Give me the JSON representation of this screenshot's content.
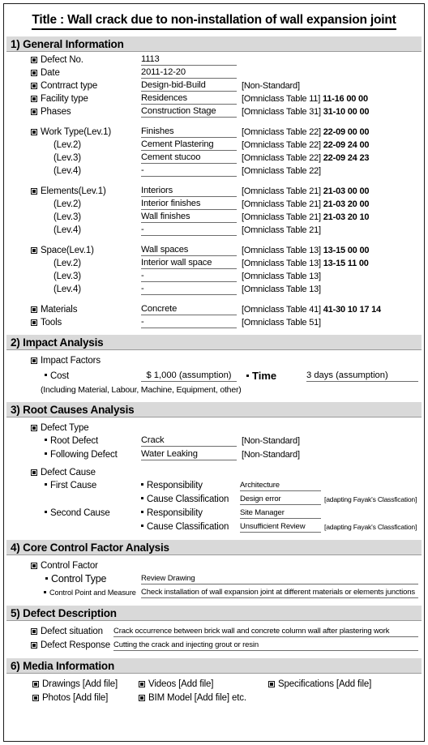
{
  "title": "Title : Wall crack due to non-installation of wall expansion joint",
  "sections": {
    "general": {
      "header": "1) General Information",
      "rows": [
        {
          "label": "Defect No.",
          "value": "1113",
          "note": ""
        },
        {
          "label": "Date",
          "value": "2011-12-20",
          "note": ""
        },
        {
          "label": "Contrract type",
          "value": "Design-bid-Build",
          "note": "[Non-Standard]",
          "code": ""
        },
        {
          "label": "Facility type",
          "value": "Residences",
          "note": "[Omniclass Table 11]",
          "code": "11-16 00 00"
        },
        {
          "label": "Phases",
          "value": "Construction Stage",
          "note": "[Omniclass Table 31]",
          "code": "31-10 00 00"
        }
      ],
      "work_type": [
        {
          "label": "Work Type(Lev.1)",
          "value": "Finishes",
          "note": "[Omniclass Table 22]",
          "code": "22-09 00 00"
        },
        {
          "label": "(Lev.2)",
          "value": "Cement Plastering",
          "note": "[Omniclass Table 22]",
          "code": "22-09 24 00"
        },
        {
          "label": "(Lev.3)",
          "value": "Cement stucoo",
          "note": "[Omniclass Table 22]",
          "code": "22-09 24 23"
        },
        {
          "label": "(Lev.4)",
          "value": "-",
          "note": "[Omniclass Table 22]",
          "code": ""
        }
      ],
      "elements": [
        {
          "label": "Elements(Lev.1)",
          "value": "Interiors",
          "note": "[Omniclass Table 21]",
          "code": "21-03 00 00"
        },
        {
          "label": "(Lev.2)",
          "value": "Interior finishes",
          "note": "[Omniclass Table 21]",
          "code": "21-03 20 00"
        },
        {
          "label": "(Lev.3)",
          "value": "Wall finishes",
          "note": "[Omniclass Table 21]",
          "code": "21-03 20 10"
        },
        {
          "label": "(Lev.4)",
          "value": "-",
          "note": "[Omniclass Table 21]",
          "code": ""
        }
      ],
      "space": [
        {
          "label": "Space(Lev.1)",
          "value": "Wall spaces",
          "note": "[Omniclass Table 13]",
          "code": "13-15 00 00"
        },
        {
          "label": "(Lev.2)",
          "value": "Interior wall space",
          "note": "[Omniclass Table 13]",
          "code": "13-15 11 00"
        },
        {
          "label": "(Lev.3)",
          "value": "-",
          "note": "[Omniclass Table 13]",
          "code": ""
        },
        {
          "label": "(Lev.4)",
          "value": "-",
          "note": "[Omniclass Table 13]",
          "code": ""
        }
      ],
      "materials": {
        "label": "Materials",
        "value": "Concrete",
        "note": "[Omniclass Table 41]",
        "code": "41-30 10 17 14"
      },
      "tools": {
        "label": "Tools",
        "value": "-",
        "note": "[Omniclass Table 51]",
        "code": ""
      }
    },
    "impact": {
      "header": "2) Impact Analysis",
      "factors_label": "Impact Factors",
      "cost_label": "Cost",
      "cost_value": "$ 1,000 (assumption)",
      "time_label": "Time",
      "time_value": "3 days (assumption)",
      "including": "(Including Material, Labour, Machine, Equipment, other)"
    },
    "root": {
      "header": "3) Root Causes Analysis",
      "defect_type_label": "Defect Type",
      "root_defect_label": "Root Defect",
      "root_defect_value": "Crack",
      "root_defect_note": "[Non-Standard]",
      "following_defect_label": "Following Defect",
      "following_defect_value": "Water Leaking",
      "following_defect_note": "[Non-Standard]",
      "defect_cause_label": "Defect Cause",
      "first_cause_label": "First Cause",
      "second_cause_label": "Second Cause",
      "responsibility_label": "Responsibility",
      "cause_classification_label": "Cause Classification",
      "first_responsibility": "Architecture",
      "first_classification": "Design error",
      "first_classification_note": "[adapting Fayak's Classfication]",
      "second_responsibility": "Site Manager",
      "second_classification": "Unsufficient Review",
      "second_classification_note": "[adapting Fayak's Classfication]"
    },
    "core": {
      "header": "4) Core Control Factor Analysis",
      "control_factor_label": "Control Factor",
      "control_type_label": "Control Type",
      "control_type_value": "Review Drawing",
      "control_point_label": "Control Point and Measure",
      "control_point_value": "Check installation of wall expansion joint at different materials or elements junctions"
    },
    "description": {
      "header": "5) Defect Description",
      "situation_label": "Defect situation",
      "situation_value": "Crack occurrence between brick wall and concrete column wall after plastering work",
      "response_label": "Defect Response",
      "response_value": "Cutting the crack and injecting grout or resin"
    },
    "media": {
      "header": "6) Media Information",
      "items": [
        "Drawings [Add file]",
        "Videos [Add file]",
        "Specifications [Add file]",
        "Photos [Add file]",
        "BIM Model [Add file] etc."
      ]
    }
  }
}
